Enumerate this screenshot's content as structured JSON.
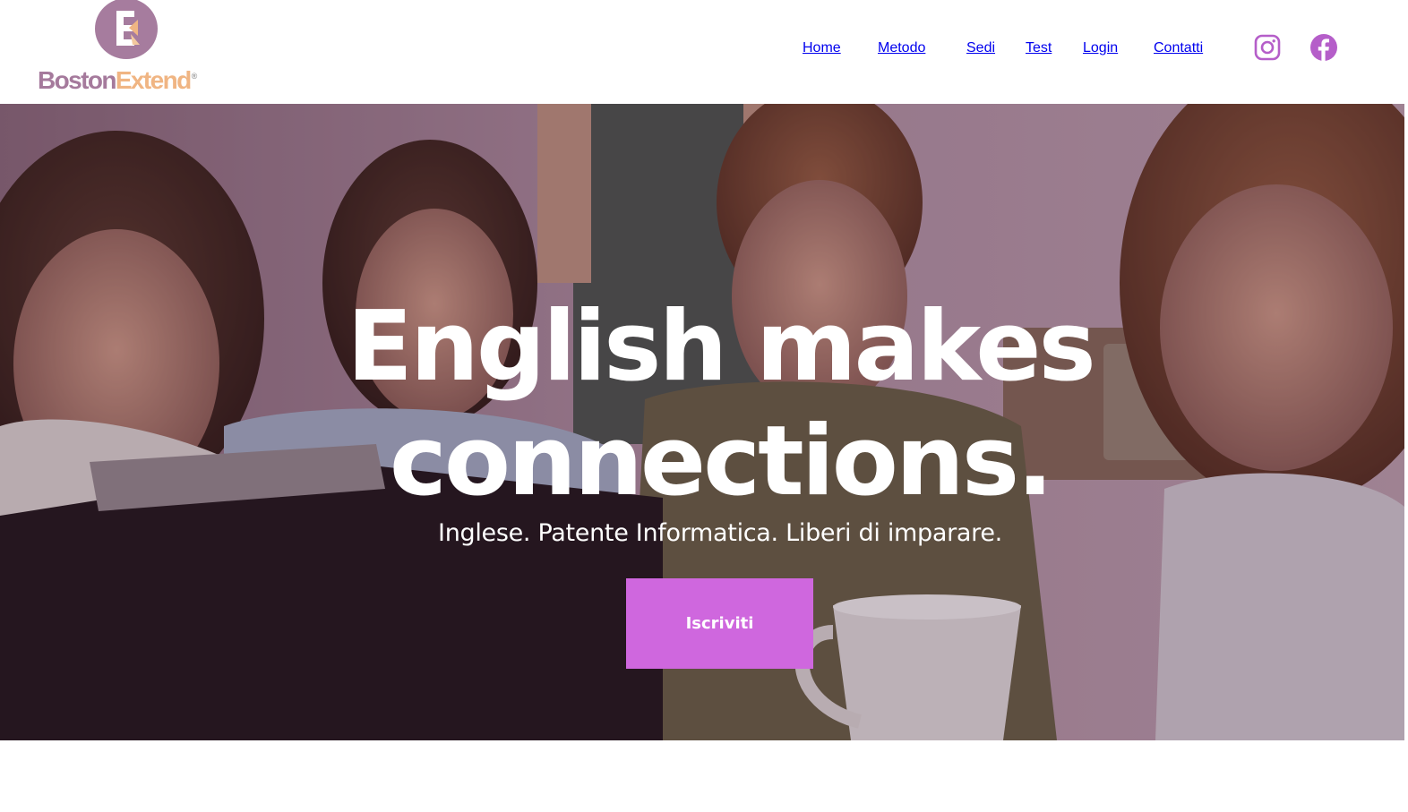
{
  "brand": {
    "name_part1": "Boston",
    "name_part2": "Extend",
    "mark": "®",
    "logo_icon": "be-monogram-logo",
    "colors": {
      "primary": "#a67c9e",
      "accent": "#f0b583"
    }
  },
  "nav": {
    "items": [
      {
        "label": "Home"
      },
      {
        "label": "Metodo"
      },
      {
        "label": "Sedi"
      },
      {
        "label": "Test"
      },
      {
        "label": "Login"
      },
      {
        "label": "Contatti"
      }
    ],
    "color": "#b55ec9",
    "social": [
      {
        "icon": "instagram-icon"
      },
      {
        "icon": "facebook-icon"
      }
    ]
  },
  "hero": {
    "headline_line1": "English makes",
    "headline_line2": "connections.",
    "subheadline": "Inglese. Patente Informatica. Liberi di imparare.",
    "cta_label": "Iscriviti",
    "cta_color": "#cf67de",
    "background": "photo-group-of-women-at-laptop"
  }
}
